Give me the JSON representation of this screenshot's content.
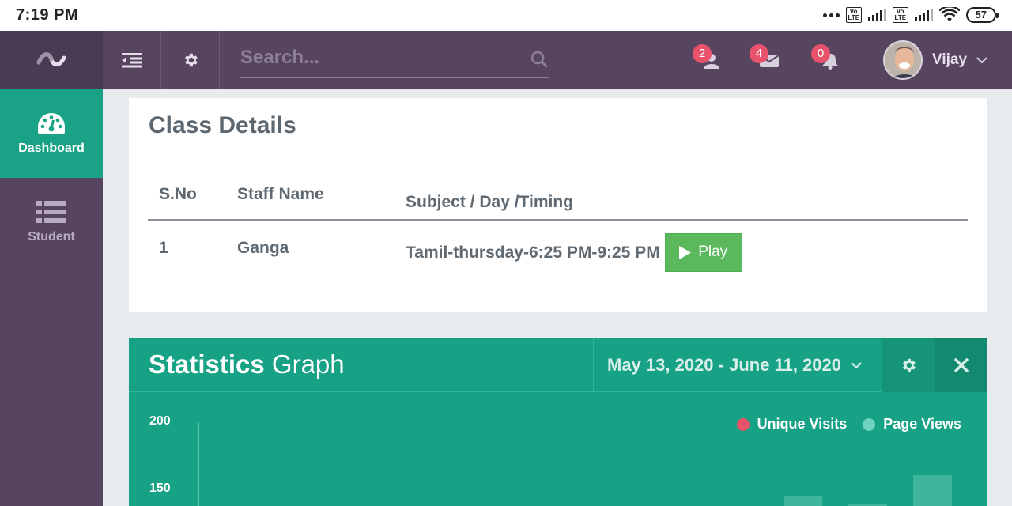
{
  "status_bar": {
    "time": "7:19 PM",
    "volte1": "Vo LTE",
    "volte2": "Vo LTE",
    "battery": "57"
  },
  "header": {
    "search_placeholder": "Search...",
    "notifications": [
      {
        "icon": "user-icon",
        "count": "2"
      },
      {
        "icon": "envelope-icon",
        "count": "4"
      },
      {
        "icon": "bell-icon",
        "count": "0"
      }
    ],
    "user_name": "Vijay"
  },
  "sidebar": {
    "items": [
      {
        "label": "Dashboard",
        "icon": "dashboard-icon",
        "active": true
      },
      {
        "label": "Student",
        "icon": "list-icon",
        "active": false
      }
    ]
  },
  "class_details": {
    "title": "Class Details",
    "columns": [
      "S.No",
      "Staff Name",
      "Subject / Day /Timing"
    ],
    "rows": [
      {
        "sno": "1",
        "staff": "Ganga",
        "subject": "Tamil-thursday-6:25 PM-9:25 PM",
        "action": "Play"
      }
    ]
  },
  "statistics": {
    "title_bold": "Statistics",
    "title_light": "Graph",
    "date_range": "May 13, 2020 - June 11, 2020",
    "legend": [
      {
        "label": "Unique Visits",
        "color": "#e8526a"
      },
      {
        "label": "Page Views",
        "color": "#6fd3bd"
      }
    ]
  },
  "chart_data": {
    "type": "bar",
    "y_ticks_visible": [
      "200",
      "150"
    ],
    "series": [
      {
        "name": "Unique Visits"
      },
      {
        "name": "Page Views"
      }
    ]
  },
  "colors": {
    "header_bg": "#574560",
    "accent": "#1aa286",
    "play_button": "#5cb85c",
    "badge": "#e8526a"
  }
}
